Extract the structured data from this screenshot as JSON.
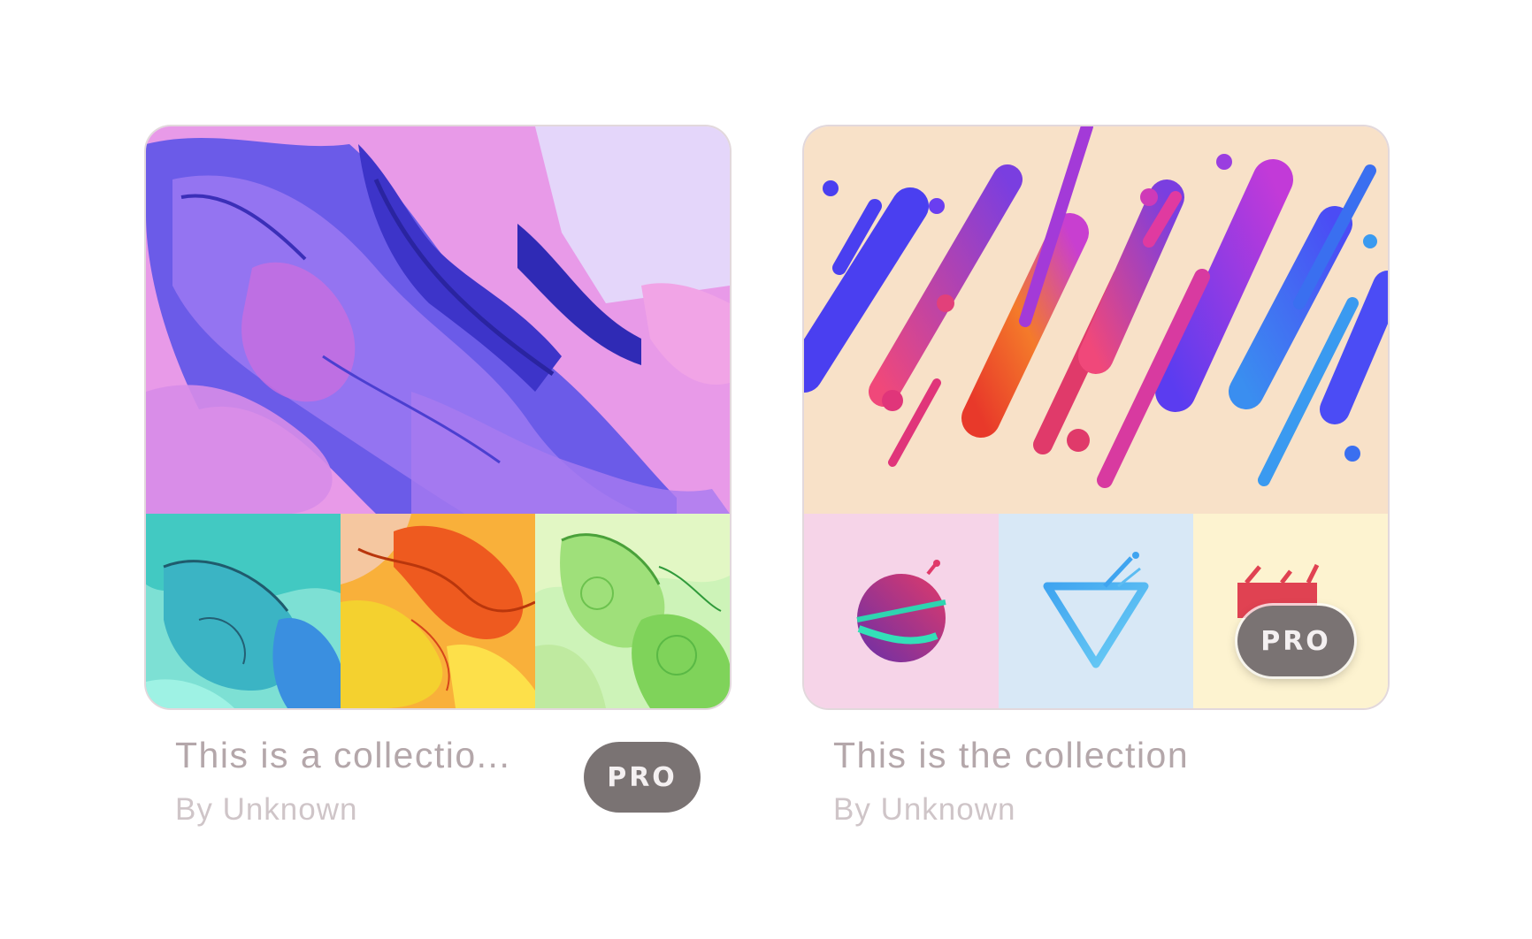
{
  "collections": [
    {
      "title": "This is a collectio...",
      "author": "By Unknown",
      "badge": "PRO"
    },
    {
      "title": "This is the collection",
      "author": "By Unknown",
      "badge": "PRO"
    }
  ],
  "colors": {
    "badge_bg": "#7a7373",
    "title_text": "#b4a7aa",
    "author_text": "#cfc5c8",
    "card_border": "#e2d8dc"
  }
}
